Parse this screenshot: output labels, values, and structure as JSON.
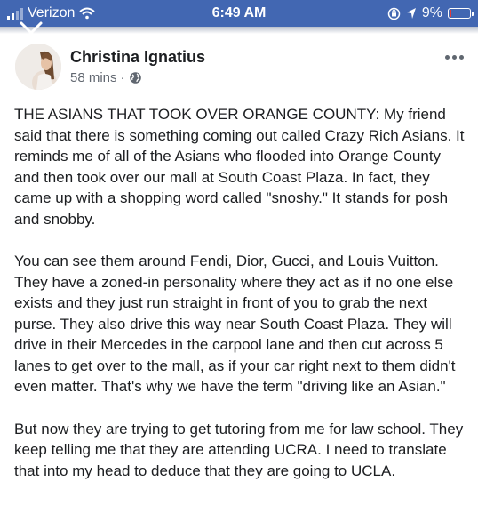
{
  "status_bar": {
    "carrier": "Verizon",
    "time": "6:49 AM",
    "battery_percent": "9%",
    "battery_level": 0.09,
    "battery_color": "#e23b3b",
    "bar_color": "#4267b2"
  },
  "icons": {
    "close": "close-icon",
    "wifi": "wifi-icon",
    "orientation_lock": "orientation-lock-icon",
    "location": "location-arrow-icon",
    "globe": "globe-icon",
    "more": "more-options-icon"
  },
  "post": {
    "author": "Christina Ignatius",
    "time_ago": "58 mins",
    "separator": "·",
    "paragraphs": [
      "THE ASIANS THAT TOOK OVER ORANGE COUNTY: My friend said that there is something coming out called Crazy Rich Asians. It reminds me of all of the Asians who flooded into Orange County and then took over our mall at South Coast Plaza. In fact, they came up with a shopping word called \"snoshy.\" It stands for posh and snobby.",
      "You can see them around Fendi, Dior, Gucci, and Louis Vuitton. They have a zoned-in personality where they act as if no one else exists and they just run straight in front of you to grab the next purse. They also drive this way near South Coast Plaza. They will drive in their Mercedes in the carpool lane and then cut across 5 lanes to get over to the mall, as if your car right next to them didn't even matter. That's why we have the term \"driving like an Asian.\"",
      "But now they are trying to get tutoring from me for law school. They keep telling me that they are attending UCRA. I need to translate that into my head to deduce that they are going to UCLA."
    ]
  }
}
